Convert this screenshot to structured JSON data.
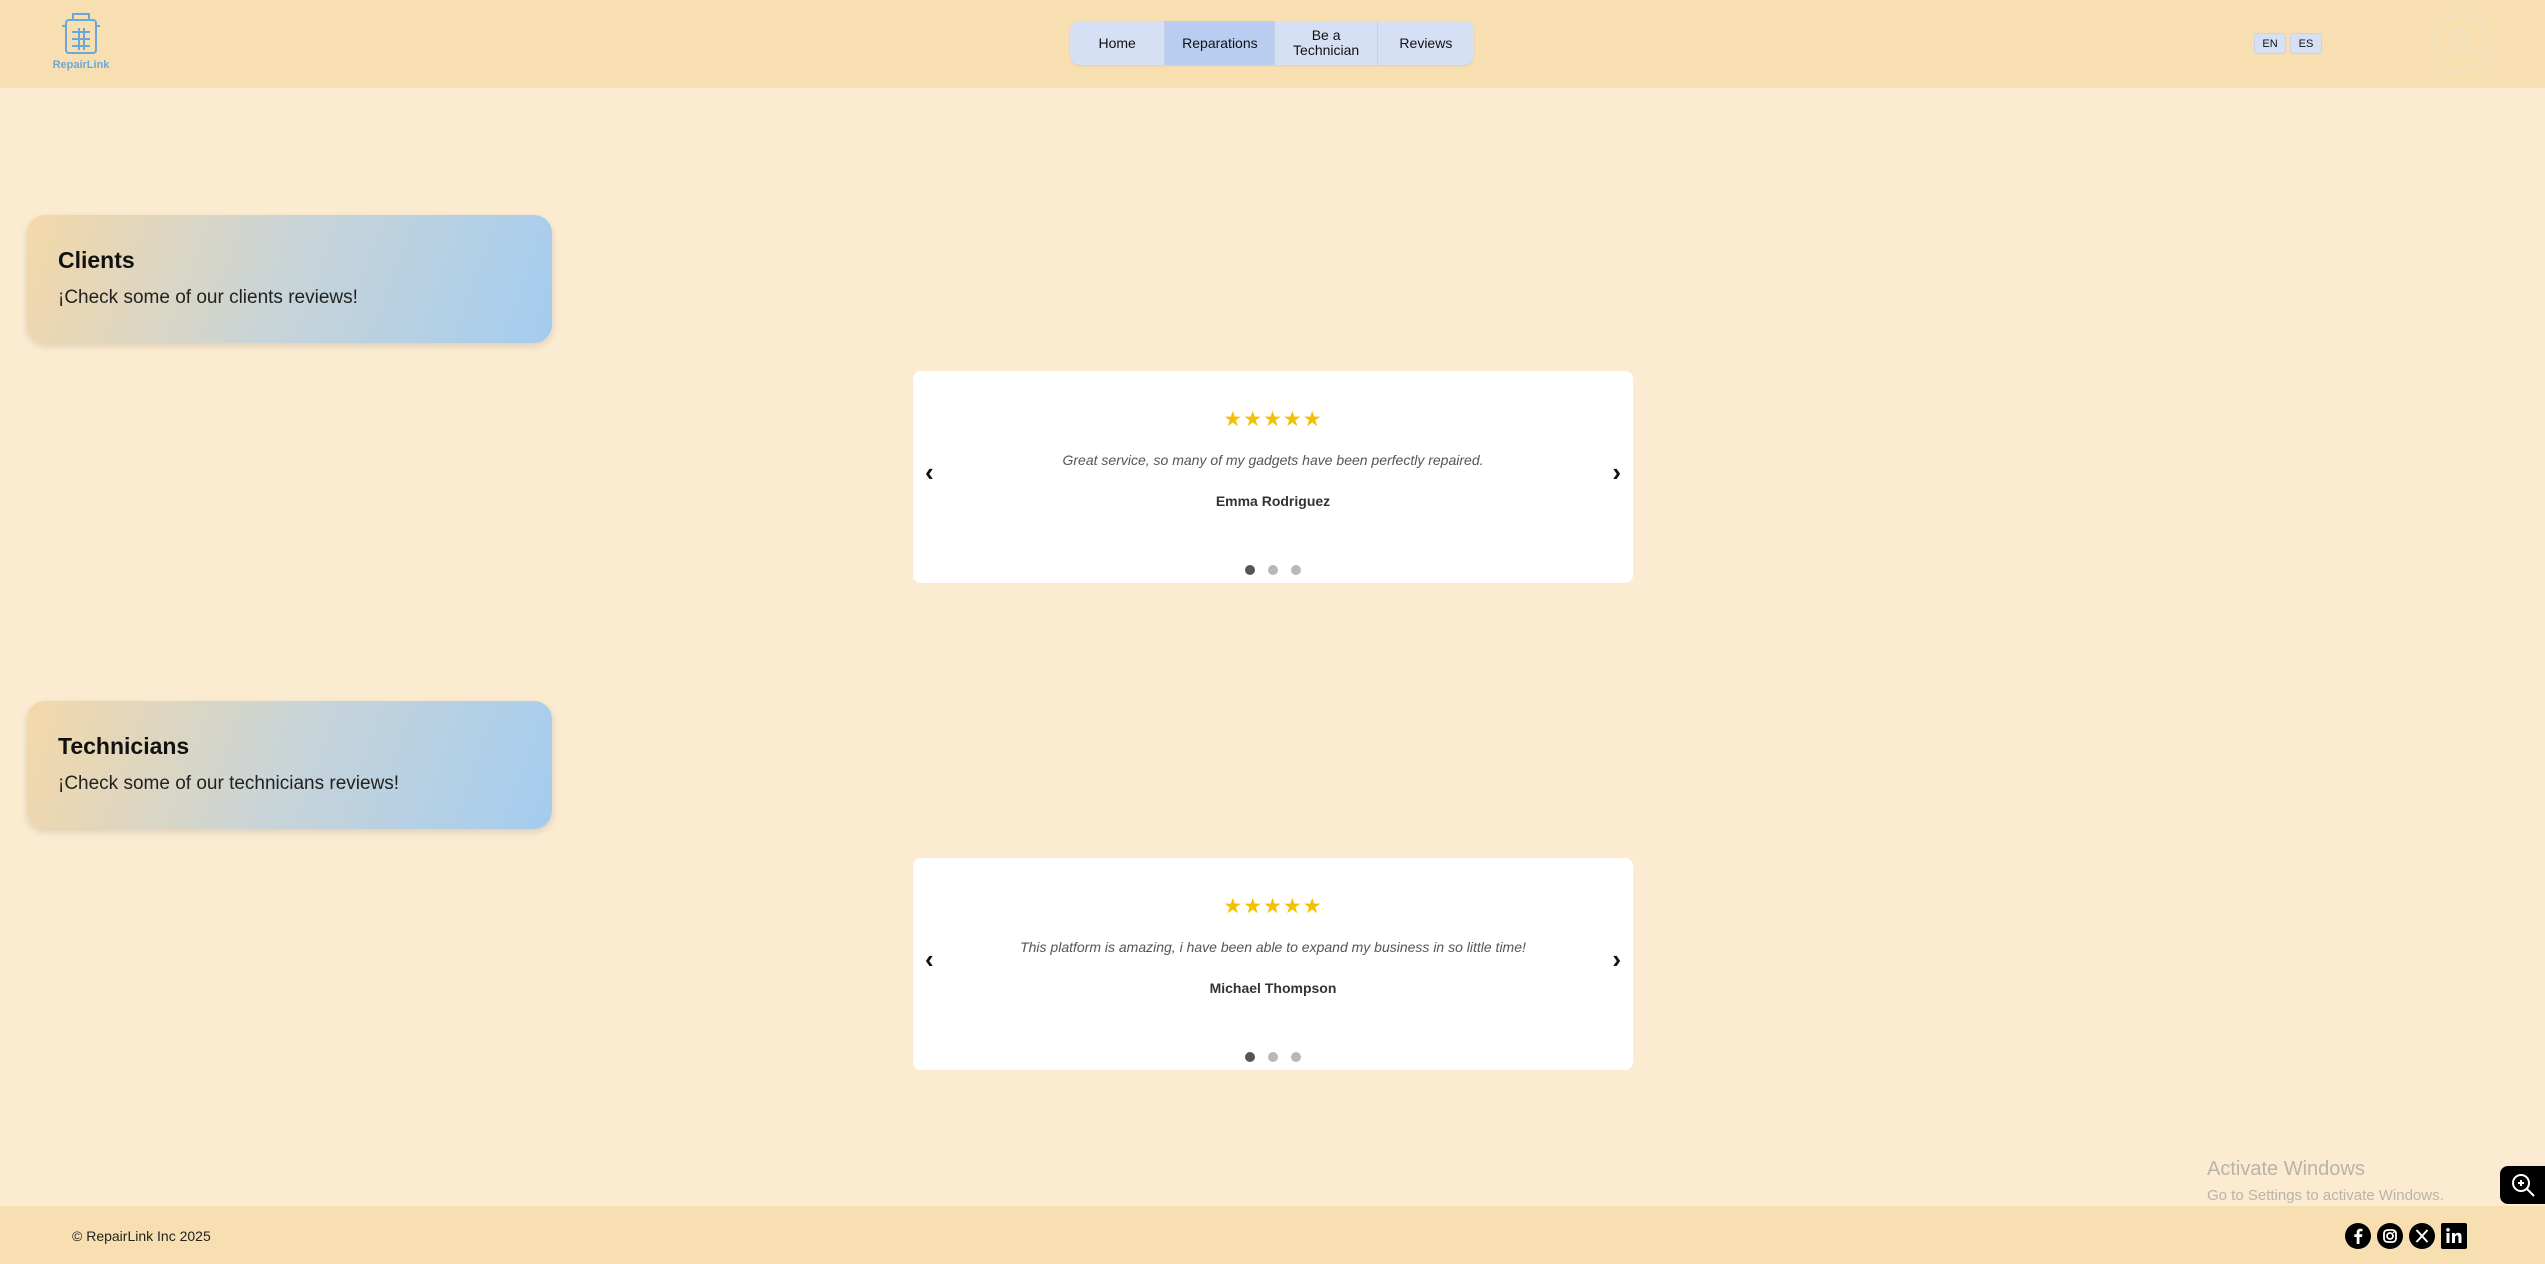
{
  "header": {
    "logo_text": "RepairLink",
    "nav": [
      {
        "label": "Home",
        "active": false
      },
      {
        "label": "Reparations",
        "active": true
      },
      {
        "label": "Be a\nTechnician",
        "active": false
      },
      {
        "label": "Reviews",
        "active": false
      }
    ],
    "languages": [
      "EN",
      "ES"
    ]
  },
  "sections": {
    "clients": {
      "title": "Clients",
      "subtitle": "¡Check some of our clients reviews!",
      "review": {
        "stars": "★★★★★",
        "text": "Great service, so many of my gadgets have been perfectly repaired.",
        "author": "Emma Rodriguez",
        "prev": "‹",
        "next": "›"
      }
    },
    "technicians": {
      "title": "Technicians",
      "subtitle": "¡Check some of our technicians reviews!",
      "review": {
        "stars": "★★★★★",
        "text": "This platform is amazing, i have been able to expand my business in so little time!",
        "author": "Michael Thompson",
        "prev": "‹",
        "next": "›"
      }
    }
  },
  "watermark": {
    "title": "Activate Windows",
    "subtitle": "Go to Settings to activate Windows."
  },
  "footer": {
    "copyright": "© RepairLink Inc 2025",
    "socials": [
      "facebook-icon",
      "instagram-icon",
      "x-icon",
      "linkedin-icon"
    ]
  },
  "colors": {
    "page_bg": "#fbebd1",
    "header_bg": "#f7dfb1",
    "nav_bg": "#d6e0f5",
    "nav_active": "#b9cdf1",
    "star": "#f2c200",
    "logo": "#6aa8dc"
  }
}
